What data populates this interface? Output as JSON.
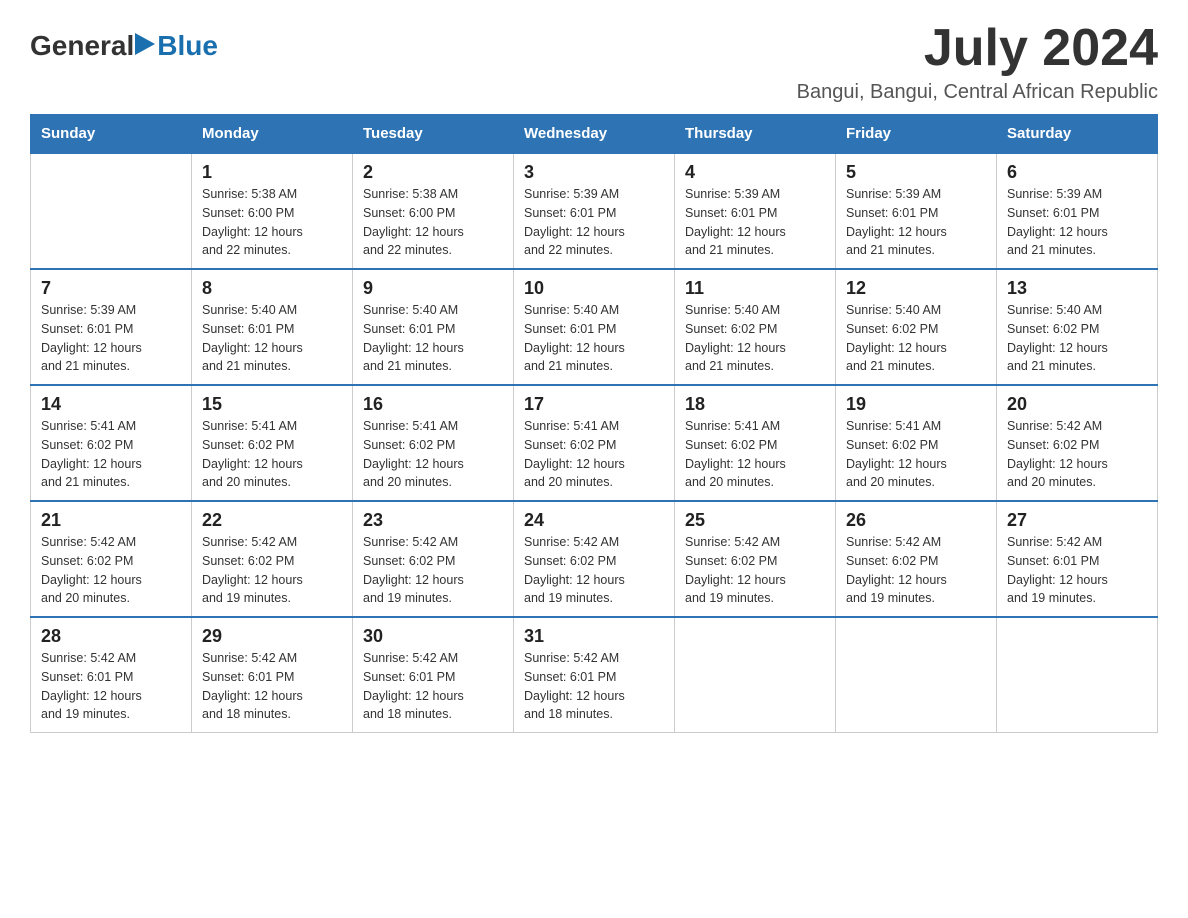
{
  "logo": {
    "text_general": "General",
    "text_blue": "Blue"
  },
  "title": {
    "month": "July 2024",
    "location": "Bangui, Bangui, Central African Republic"
  },
  "headers": [
    "Sunday",
    "Monday",
    "Tuesday",
    "Wednesday",
    "Thursday",
    "Friday",
    "Saturday"
  ],
  "weeks": [
    [
      {
        "day": "",
        "info": ""
      },
      {
        "day": "1",
        "info": "Sunrise: 5:38 AM\nSunset: 6:00 PM\nDaylight: 12 hours\nand 22 minutes."
      },
      {
        "day": "2",
        "info": "Sunrise: 5:38 AM\nSunset: 6:00 PM\nDaylight: 12 hours\nand 22 minutes."
      },
      {
        "day": "3",
        "info": "Sunrise: 5:39 AM\nSunset: 6:01 PM\nDaylight: 12 hours\nand 22 minutes."
      },
      {
        "day": "4",
        "info": "Sunrise: 5:39 AM\nSunset: 6:01 PM\nDaylight: 12 hours\nand 21 minutes."
      },
      {
        "day": "5",
        "info": "Sunrise: 5:39 AM\nSunset: 6:01 PM\nDaylight: 12 hours\nand 21 minutes."
      },
      {
        "day": "6",
        "info": "Sunrise: 5:39 AM\nSunset: 6:01 PM\nDaylight: 12 hours\nand 21 minutes."
      }
    ],
    [
      {
        "day": "7",
        "info": "Sunrise: 5:39 AM\nSunset: 6:01 PM\nDaylight: 12 hours\nand 21 minutes."
      },
      {
        "day": "8",
        "info": "Sunrise: 5:40 AM\nSunset: 6:01 PM\nDaylight: 12 hours\nand 21 minutes."
      },
      {
        "day": "9",
        "info": "Sunrise: 5:40 AM\nSunset: 6:01 PM\nDaylight: 12 hours\nand 21 minutes."
      },
      {
        "day": "10",
        "info": "Sunrise: 5:40 AM\nSunset: 6:01 PM\nDaylight: 12 hours\nand 21 minutes."
      },
      {
        "day": "11",
        "info": "Sunrise: 5:40 AM\nSunset: 6:02 PM\nDaylight: 12 hours\nand 21 minutes."
      },
      {
        "day": "12",
        "info": "Sunrise: 5:40 AM\nSunset: 6:02 PM\nDaylight: 12 hours\nand 21 minutes."
      },
      {
        "day": "13",
        "info": "Sunrise: 5:40 AM\nSunset: 6:02 PM\nDaylight: 12 hours\nand 21 minutes."
      }
    ],
    [
      {
        "day": "14",
        "info": "Sunrise: 5:41 AM\nSunset: 6:02 PM\nDaylight: 12 hours\nand 21 minutes."
      },
      {
        "day": "15",
        "info": "Sunrise: 5:41 AM\nSunset: 6:02 PM\nDaylight: 12 hours\nand 20 minutes."
      },
      {
        "day": "16",
        "info": "Sunrise: 5:41 AM\nSunset: 6:02 PM\nDaylight: 12 hours\nand 20 minutes."
      },
      {
        "day": "17",
        "info": "Sunrise: 5:41 AM\nSunset: 6:02 PM\nDaylight: 12 hours\nand 20 minutes."
      },
      {
        "day": "18",
        "info": "Sunrise: 5:41 AM\nSunset: 6:02 PM\nDaylight: 12 hours\nand 20 minutes."
      },
      {
        "day": "19",
        "info": "Sunrise: 5:41 AM\nSunset: 6:02 PM\nDaylight: 12 hours\nand 20 minutes."
      },
      {
        "day": "20",
        "info": "Sunrise: 5:42 AM\nSunset: 6:02 PM\nDaylight: 12 hours\nand 20 minutes."
      }
    ],
    [
      {
        "day": "21",
        "info": "Sunrise: 5:42 AM\nSunset: 6:02 PM\nDaylight: 12 hours\nand 20 minutes."
      },
      {
        "day": "22",
        "info": "Sunrise: 5:42 AM\nSunset: 6:02 PM\nDaylight: 12 hours\nand 19 minutes."
      },
      {
        "day": "23",
        "info": "Sunrise: 5:42 AM\nSunset: 6:02 PM\nDaylight: 12 hours\nand 19 minutes."
      },
      {
        "day": "24",
        "info": "Sunrise: 5:42 AM\nSunset: 6:02 PM\nDaylight: 12 hours\nand 19 minutes."
      },
      {
        "day": "25",
        "info": "Sunrise: 5:42 AM\nSunset: 6:02 PM\nDaylight: 12 hours\nand 19 minutes."
      },
      {
        "day": "26",
        "info": "Sunrise: 5:42 AM\nSunset: 6:02 PM\nDaylight: 12 hours\nand 19 minutes."
      },
      {
        "day": "27",
        "info": "Sunrise: 5:42 AM\nSunset: 6:01 PM\nDaylight: 12 hours\nand 19 minutes."
      }
    ],
    [
      {
        "day": "28",
        "info": "Sunrise: 5:42 AM\nSunset: 6:01 PM\nDaylight: 12 hours\nand 19 minutes."
      },
      {
        "day": "29",
        "info": "Sunrise: 5:42 AM\nSunset: 6:01 PM\nDaylight: 12 hours\nand 18 minutes."
      },
      {
        "day": "30",
        "info": "Sunrise: 5:42 AM\nSunset: 6:01 PM\nDaylight: 12 hours\nand 18 minutes."
      },
      {
        "day": "31",
        "info": "Sunrise: 5:42 AM\nSunset: 6:01 PM\nDaylight: 12 hours\nand 18 minutes."
      },
      {
        "day": "",
        "info": ""
      },
      {
        "day": "",
        "info": ""
      },
      {
        "day": "",
        "info": ""
      }
    ]
  ]
}
